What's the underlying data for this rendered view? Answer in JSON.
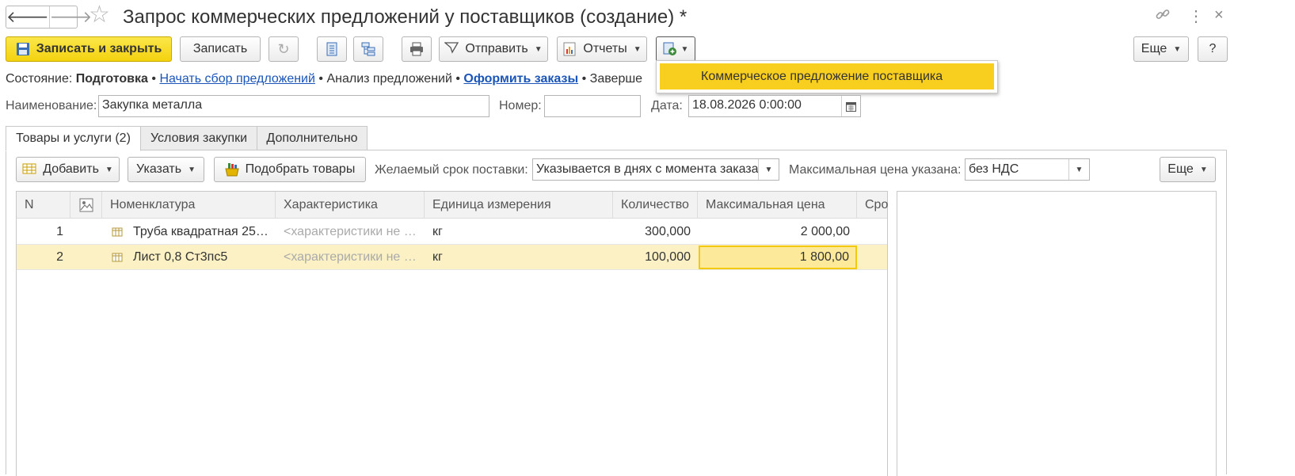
{
  "window": {
    "title": "Запрос коммерческих предложений у поставщиков (создание) *",
    "nav_back_icon": "arrow-left-icon",
    "nav_forward_icon": "arrow-right-icon",
    "favorite_icon": "star-icon",
    "link_icon": "link-icon",
    "menu_icon": "more-vertical-icon",
    "close_icon": "close-icon",
    "close_glyph": "×",
    "more_glyph": "⋮"
  },
  "toolbar": {
    "save_close_label": "Записать и закрыть",
    "save_label": "Записать",
    "send_label": "Отправить",
    "reports_label": "Отчеты",
    "more_label": "Еще",
    "help_label": "?"
  },
  "popup": {
    "item_label": "Коммерческое предложение поставщика"
  },
  "state": {
    "label": "Состояние:",
    "current": "Подготовка",
    "sep": "•",
    "step1": "Начать сбор предложений",
    "step2": "Анализ предложений",
    "step3": "Оформить заказы",
    "step4": "Заверше"
  },
  "fields": {
    "name_label": "Наименование:",
    "name_value": "Закупка металла",
    "number_label": "Номер:",
    "number_value": "",
    "date_label": "Дата:",
    "date_value": "18.08.2026  0:00:00"
  },
  "tabs": [
    {
      "label": "Товары и услуги (2)",
      "active": true
    },
    {
      "label": "Условия закупки",
      "active": false
    },
    {
      "label": "Дополнительно",
      "active": false
    }
  ],
  "goods_toolbar": {
    "add_label": "Добавить",
    "specify_label": "Указать",
    "pick_label": "Подобрать товары",
    "delivery_label": "Желаемый срок поставки:",
    "delivery_value": "Указывается в днях с момента заказа",
    "price_label": "Максимальная цена указана:",
    "price_value": "без НДС",
    "more_label": "Еще"
  },
  "table": {
    "columns": [
      "N",
      "",
      "Номенклатура",
      "Характеристика",
      "Единица измерения",
      "Количество",
      "Максимальная цена",
      "Сро"
    ],
    "rows": [
      {
        "n": "1",
        "item": "Труба квадратная 25…",
        "char": "<характеристики не …",
        "unit": "кг",
        "qty": "300,000",
        "price": "2 000,00",
        "selected": false
      },
      {
        "n": "2",
        "item": "Лист 0,8 Ст3пс5",
        "char": "<характеристики не …",
        "unit": "кг",
        "qty": "100,000",
        "price": "1 800,00",
        "selected": true
      }
    ]
  },
  "colors": {
    "primary": "#f4d20f",
    "link": "#1a55b8",
    "selected_row": "#fbf1c4",
    "popup_highlight": "#f9cf1f"
  }
}
